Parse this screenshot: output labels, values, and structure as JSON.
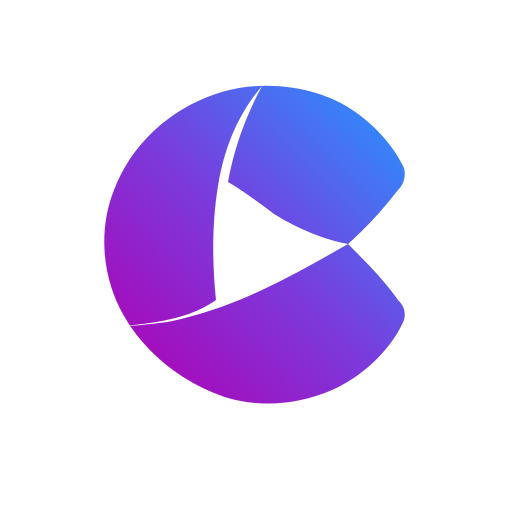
{
  "logo": {
    "icon": "play-c-logo-icon",
    "colors": {
      "background": "#ffffff",
      "gradient_start": "#b000b4",
      "gradient_mid": "#7a3bdc",
      "gradient_end": "#2a90ff",
      "cutout": "#ffffff"
    }
  }
}
